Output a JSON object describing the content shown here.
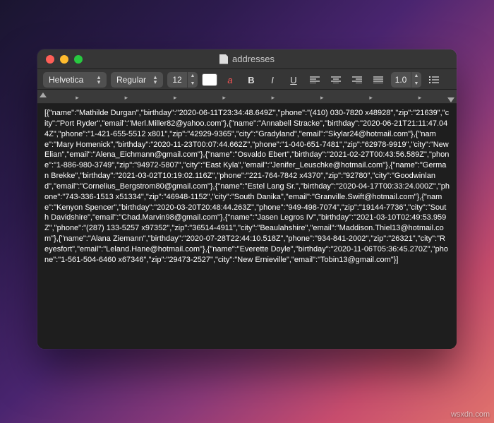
{
  "window": {
    "title": "addresses"
  },
  "toolbar": {
    "font_family": "Helvetica",
    "font_style": "Regular",
    "font_size": "12",
    "line_spacing": "1.0"
  },
  "body_text": "[{\"name\":\"Mathilde Durgan\",\"birthday\":\"2020-06-11T23:34:48.649Z\",\"phone\":\"(410) 030-7820 x48928\",\"zip\":\"21639\",\"city\":\"Port Ryder\",\"email\":\"Merl.Miller82@yahoo.com\"},{\"name\":\"Annabell Stracke\",\"birthday\":\"2020-06-21T21:11:47.044Z\",\"phone\":\"1-421-655-5512 x801\",\"zip\":\"42929-9365\",\"city\":\"Gradyland\",\"email\":\"Skylar24@hotmail.com\"},{\"name\":\"Mary Homenick\",\"birthday\":\"2020-11-23T00:07:44.662Z\",\"phone\":\"1-040-651-7481\",\"zip\":\"62978-9919\",\"city\":\"New Elian\",\"email\":\"Alena_Eichmann@gmail.com\"},{\"name\":\"Osvaldo Ebert\",\"birthday\":\"2021-02-27T00:43:56.589Z\",\"phone\":\"1-886-980-3749\",\"zip\":\"94972-5807\",\"city\":\"East Kyla\",\"email\":\"Jenifer_Leuschke@hotmail.com\"},{\"name\":\"German Brekke\",\"birthday\":\"2021-03-02T10:19:02.116Z\",\"phone\":\"221-764-7842 x4370\",\"zip\":\"92780\",\"city\":\"Goodwinland\",\"email\":\"Cornelius_Bergstrom80@gmail.com\"},{\"name\":\"Estel Lang Sr.\",\"birthday\":\"2020-04-17T00:33:24.000Z\",\"phone\":\"743-336-1513 x51334\",\"zip\":\"46948-1152\",\"city\":\"South Danika\",\"email\":\"Granville.Swift@hotmail.com\"},{\"name\":\"Kenyon Spencer\",\"birthday\":\"2020-03-20T20:48:44.263Z\",\"phone\":\"949-498-7074\",\"zip\":\"19144-7736\",\"city\":\"South Davidshire\",\"email\":\"Chad.Marvin98@gmail.com\"},{\"name\":\"Jasen Legros IV\",\"birthday\":\"2021-03-10T02:49:53.959Z\",\"phone\":\"(287) 133-5257 x97352\",\"zip\":\"36514-4911\",\"city\":\"Beaulahshire\",\"email\":\"Maddison.Thiel13@hotmail.com\"},{\"name\":\"Alana Ziemann\",\"birthday\":\"2020-07-28T22:44:10.518Z\",\"phone\":\"934-841-2002\",\"zip\":\"26321\",\"city\":\"Reyesfort\",\"email\":\"Leland.Hane@hotmail.com\"},{\"name\":\"Everette Doyle\",\"birthday\":\"2020-11-06T05:36:45.270Z\",\"phone\":\"1-561-504-6460 x67346\",\"zip\":\"29473-2527\",\"city\":\"New Ernieville\",\"email\":\"Tobin13@gmail.com\"}]",
  "watermark": "wsxdn.com"
}
